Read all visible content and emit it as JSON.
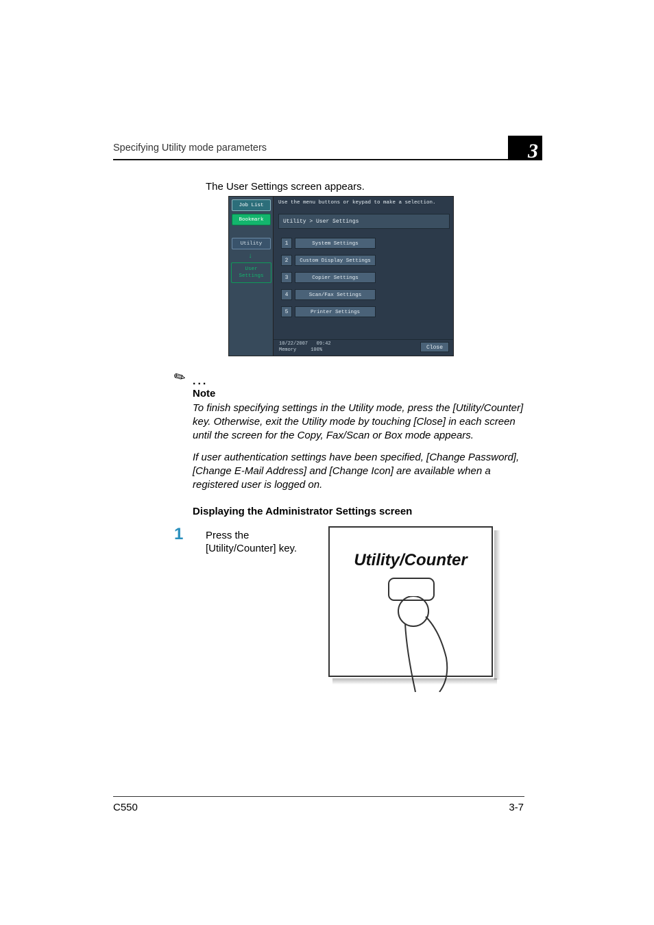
{
  "header": {
    "title": "Specifying Utility mode parameters",
    "chapter_number": "3"
  },
  "intro": "The User Settings screen appears.",
  "screenshot": {
    "sidebar": {
      "job_list": "Job List",
      "bookmark": "Bookmark",
      "utility": "Utility",
      "arrow": "↓",
      "user_settings": "User Settings"
    },
    "top_message": "Use the menu buttons or keypad to make a selection.",
    "breadcrumb": "Utility > User Settings",
    "items": [
      {
        "num": "1",
        "label": "System Settings"
      },
      {
        "num": "2",
        "label": "Custom Display Settings"
      },
      {
        "num": "3",
        "label": "Copier Settings"
      },
      {
        "num": "4",
        "label": "Scan/Fax Settings"
      },
      {
        "num": "5",
        "label": "Printer Settings"
      }
    ],
    "footer": {
      "date": "10/22/2007",
      "time": "09:42",
      "memory_label": "Memory",
      "memory_value": "100%",
      "close": "Close"
    }
  },
  "note": {
    "dots": "...",
    "label": "Note",
    "p1": "To finish specifying settings in the Utility mode, press the [Utility/Counter] key. Otherwise, exit the Utility mode by touching [Close] in each screen until the screen for the Copy, Fax/Scan or Box mode appears.",
    "p2": "If user authentication settings have been specified, [Change Password], [Change E-Mail Address] and [Change Icon] are available when a registered user is logged on."
  },
  "subheading": "Displaying the Administrator Settings screen",
  "step": {
    "num": "1",
    "text": "Press the [Utility/Counter] key."
  },
  "drawing": {
    "title": "Utility/Counter"
  },
  "footer": {
    "left": "C550",
    "right": "3-7"
  }
}
